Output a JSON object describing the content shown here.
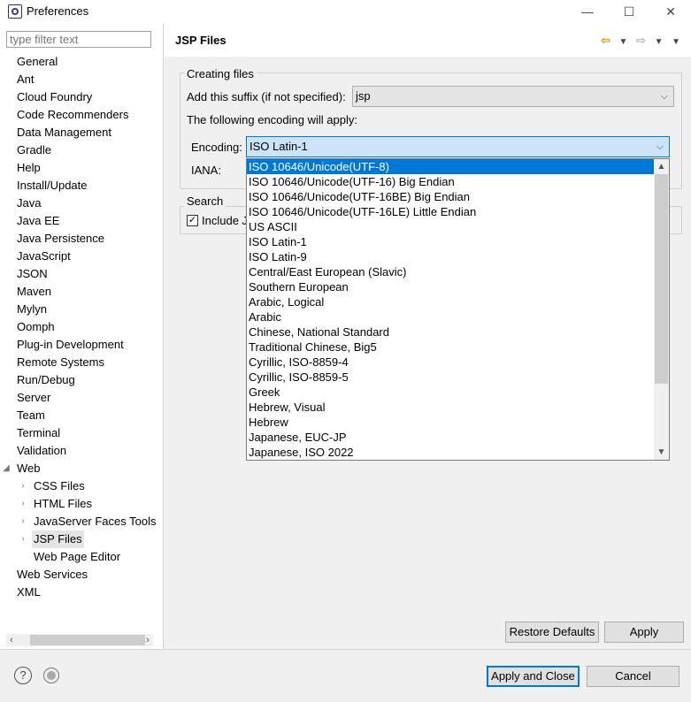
{
  "window": {
    "title": "Preferences",
    "minimize_glyph": "—",
    "maximize_glyph": "☐",
    "close_glyph": "✕"
  },
  "filter": {
    "placeholder": "type filter text"
  },
  "tree": [
    {
      "label": "General",
      "expandable": true,
      "indent": 0
    },
    {
      "label": "Ant",
      "expandable": true,
      "indent": 0
    },
    {
      "label": "Cloud Foundry",
      "expandable": true,
      "indent": 0
    },
    {
      "label": "Code Recommenders",
      "expandable": true,
      "indent": 0
    },
    {
      "label": "Data Management",
      "expandable": true,
      "indent": 0
    },
    {
      "label": "Gradle",
      "expandable": false,
      "indent": 0
    },
    {
      "label": "Help",
      "expandable": true,
      "indent": 0
    },
    {
      "label": "Install/Update",
      "expandable": true,
      "indent": 0
    },
    {
      "label": "Java",
      "expandable": true,
      "indent": 0
    },
    {
      "label": "Java EE",
      "expandable": true,
      "indent": 0
    },
    {
      "label": "Java Persistence",
      "expandable": true,
      "indent": 0
    },
    {
      "label": "JavaScript",
      "expandable": true,
      "indent": 0
    },
    {
      "label": "JSON",
      "expandable": true,
      "indent": 0
    },
    {
      "label": "Maven",
      "expandable": true,
      "indent": 0
    },
    {
      "label": "Mylyn",
      "expandable": true,
      "indent": 0
    },
    {
      "label": "Oomph",
      "expandable": true,
      "indent": 0
    },
    {
      "label": "Plug-in Development",
      "expandable": true,
      "indent": 0
    },
    {
      "label": "Remote Systems",
      "expandable": true,
      "indent": 0
    },
    {
      "label": "Run/Debug",
      "expandable": true,
      "indent": 0
    },
    {
      "label": "Server",
      "expandable": true,
      "indent": 0
    },
    {
      "label": "Team",
      "expandable": true,
      "indent": 0
    },
    {
      "label": "Terminal",
      "expandable": true,
      "indent": 0
    },
    {
      "label": "Validation",
      "expandable": false,
      "indent": 0
    },
    {
      "label": "Web",
      "expandable": true,
      "expanded": true,
      "indent": 0
    },
    {
      "label": "CSS Files",
      "expandable": true,
      "indent": 1
    },
    {
      "label": "HTML Files",
      "expandable": true,
      "indent": 1
    },
    {
      "label": "JavaServer Faces Tools",
      "expandable": true,
      "indent": 1
    },
    {
      "label": "JSP Files",
      "expandable": true,
      "indent": 1,
      "selected": true
    },
    {
      "label": "Web Page Editor",
      "expandable": false,
      "indent": 1
    },
    {
      "label": "Web Services",
      "expandable": true,
      "indent": 0
    },
    {
      "label": "XML",
      "expandable": true,
      "indent": 0
    }
  ],
  "page": {
    "title": "JSP Files",
    "creating_group": "Creating files",
    "suffix_label": "Add this suffix (if not specified):",
    "suffix_value": "jsp",
    "encoding_info": "The following encoding will apply:",
    "encoding_label": "Encoding:",
    "encoding_value": "ISO Latin-1",
    "iana_label": "IANA:",
    "search_group": "Search",
    "include_label": "Include J"
  },
  "encoding_options": [
    "ISO 10646/Unicode(UTF-8)",
    "ISO 10646/Unicode(UTF-16) Big Endian",
    "ISO 10646/Unicode(UTF-16BE) Big Endian",
    "ISO 10646/Unicode(UTF-16LE) Little Endian",
    "US ASCII",
    "ISO Latin-1",
    "ISO Latin-9",
    "Central/East European (Slavic)",
    "Southern European",
    "Arabic, Logical",
    "Arabic",
    "Chinese, National Standard",
    "Traditional Chinese, Big5",
    "Cyrillic, ISO-8859-4",
    "Cyrillic, ISO-8859-5",
    "Greek",
    "Hebrew, Visual",
    "Hebrew",
    "Japanese, EUC-JP",
    "Japanese, ISO 2022"
  ],
  "buttons": {
    "restore_defaults": "Restore Defaults",
    "apply": "Apply",
    "apply_and_close": "Apply and Close",
    "cancel": "Cancel"
  },
  "colors": {
    "selection": "#0078d7",
    "accent_back_arrow": "#d9a320"
  }
}
